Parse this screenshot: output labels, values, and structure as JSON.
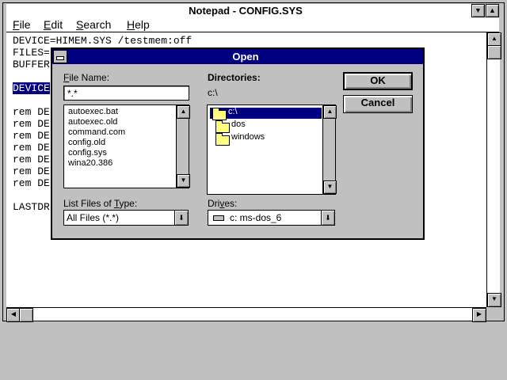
{
  "window": {
    "title": "Notepad - CONFIG.SYS",
    "sys_icon": "system-menu-icon",
    "minimize_icon": "minimize-arrow-icon",
    "maximize_icon": "maximize-arrow-icon"
  },
  "menu": {
    "file_u": "F",
    "file_rest": "ile",
    "edit_u": "E",
    "edit_rest": "dit",
    "search_u": "S",
    "search_rest": "earch",
    "help_u": "H",
    "help_rest": "elp"
  },
  "document": {
    "lines": [
      "DEVICE=HIMEM.SYS /testmem:off",
      "FILES=",
      "BUFFER",
      "DEVICE",
      "rem DE",
      "rem DE",
      "rem DE",
      "rem DE",
      "rem DE",
      "rem DE",
      "rem DE",
      "LASTDR"
    ],
    "selected_line_index": 3
  },
  "dialog": {
    "title": "Open",
    "file_name_label": "File Name:",
    "file_name_value": "*.*",
    "files": [
      "autoexec.bat",
      "autoexec.old",
      "command.com",
      "config.old",
      "config.sys",
      "wina20.386"
    ],
    "directories_label": "Directories:",
    "current_dir": "c:\\",
    "dirs": [
      "c:\\",
      "dos",
      "windows"
    ],
    "file_type_label": "List Files of Type:",
    "file_type_value": "All Files (*.*)",
    "drives_label": "Drives:",
    "drive_value": "c: ms-dos_6",
    "ok_label": "OK",
    "cancel_label": "Cancel"
  },
  "icons": {
    "folder": "folder-icon",
    "open_folder": "open-folder-icon",
    "drive": "hard-drive-icon",
    "scroll_up": "scroll-up-arrow-icon",
    "scroll_down": "scroll-down-arrow-icon",
    "dropdown": "dropdown-arrow-icon"
  },
  "colors": {
    "title_active": "#000080",
    "selection": "#000080",
    "window_bg": "#c0c0c0",
    "folder": "#ffff80"
  }
}
